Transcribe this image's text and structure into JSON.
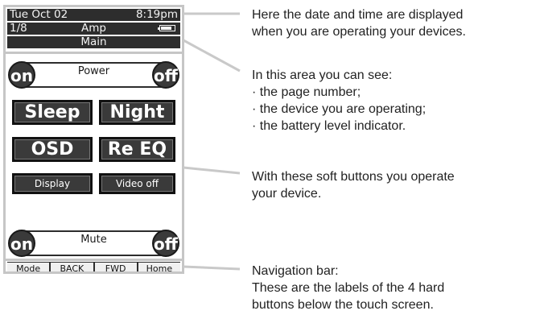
{
  "remote": {
    "status": {
      "date": "Tue Oct 02",
      "time": "8:19pm",
      "page": "1/8",
      "device": "Amp",
      "battery_level": 0.8,
      "pane": "Main"
    },
    "power": {
      "label": "Power",
      "on": "on",
      "off": "off"
    },
    "soft_buttons": {
      "sleep": "Sleep",
      "night": "Night",
      "osd": "OSD",
      "reeq": "Re EQ",
      "display": "Display",
      "videooff": "Video off"
    },
    "mute": {
      "label": "Mute",
      "on": "on",
      "off": "off"
    },
    "nav": [
      "Mode",
      "BACK",
      "FWD",
      "Home"
    ]
  },
  "descriptions": {
    "datetime": [
      "Here the date and time are displayed",
      "when you are operating your devices."
    ],
    "status_area": {
      "intro": "In this area you can see:",
      "items": [
        "· the page number;",
        "· the device you are operating;",
        "· the battery level indicator."
      ]
    },
    "soft_buttons": [
      "With these soft buttons you operate",
      "your device."
    ],
    "nav_bar": [
      "Navigation bar:",
      "These are the labels of the 4 hard",
      "buttons below the touch screen."
    ]
  },
  "colors": {
    "screen_dark": "#2d2d2d",
    "frame_gray": "#c6c6c6",
    "line_gray": "#c9c9c9"
  }
}
